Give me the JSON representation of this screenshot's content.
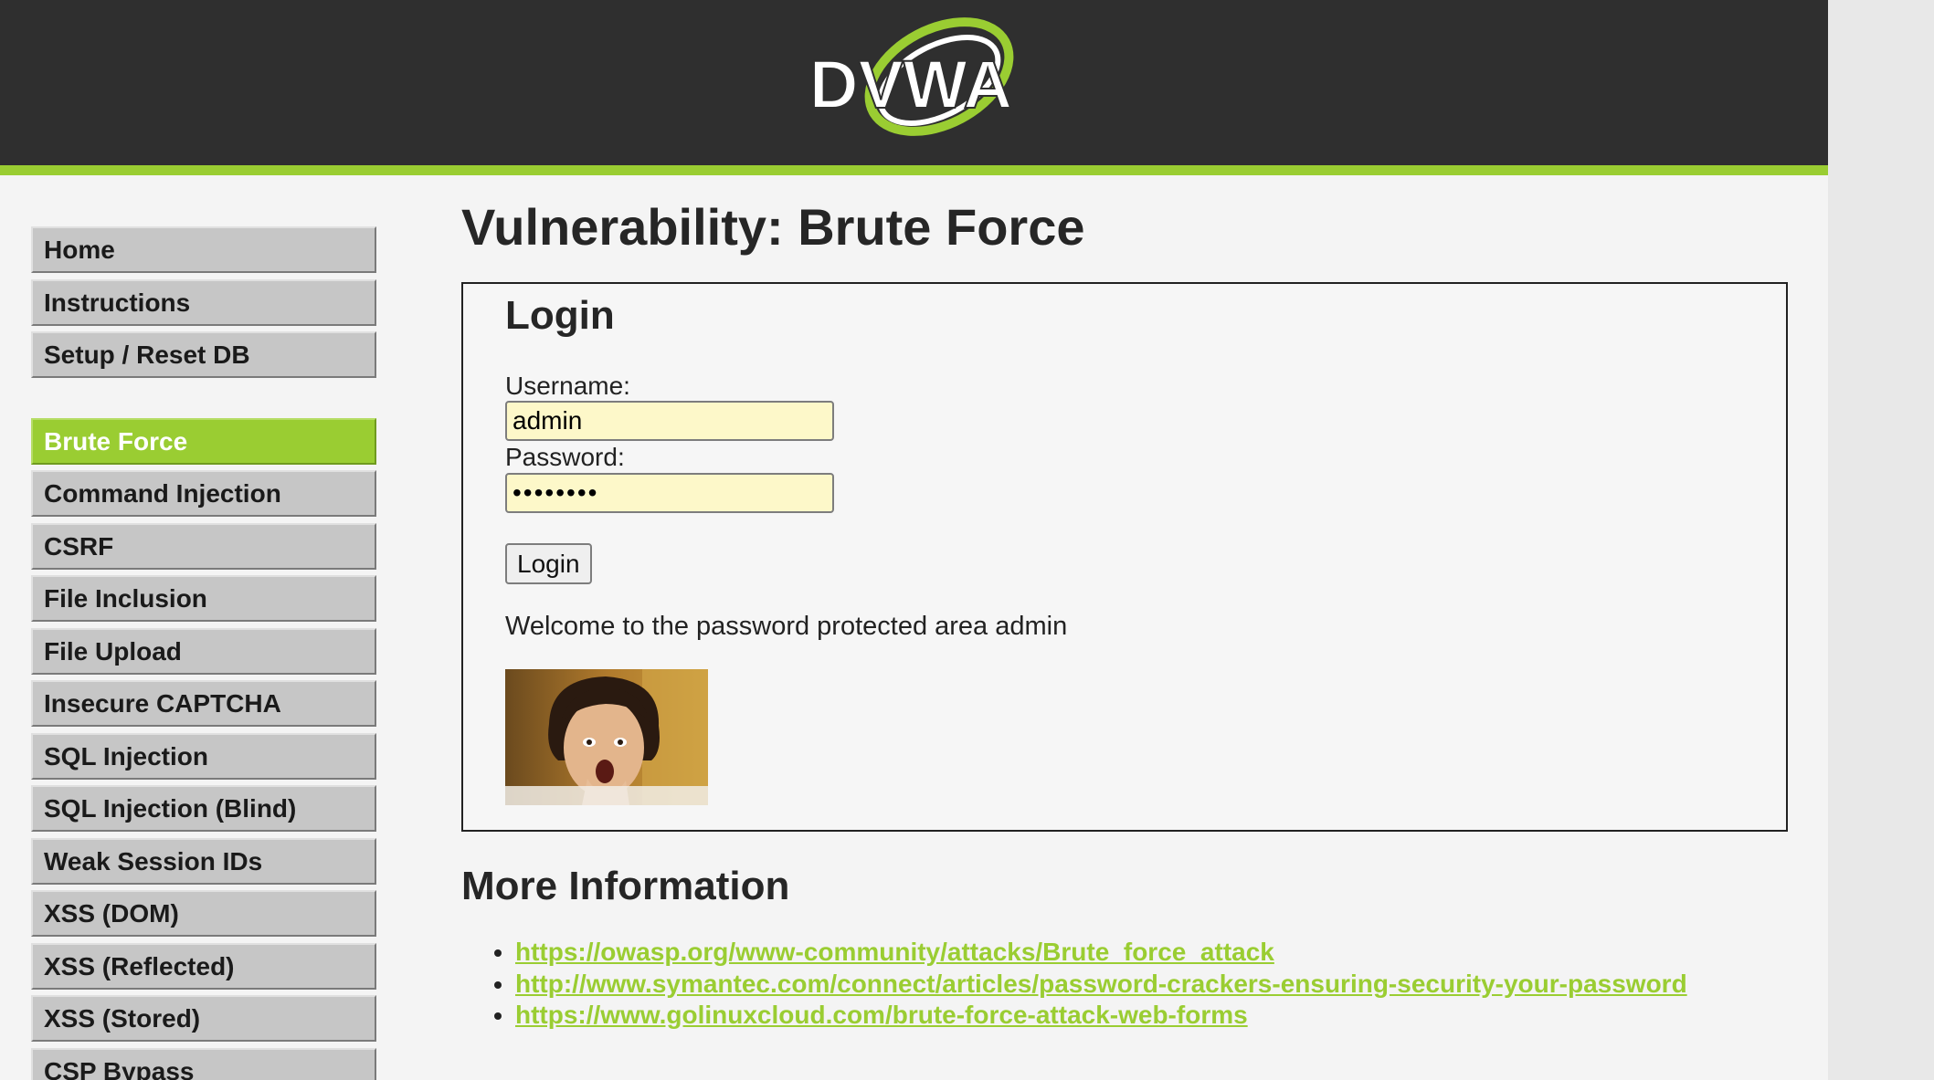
{
  "colors": {
    "header_bg": "#2f2f2f",
    "accent_green": "#9acd32",
    "nav_bg": "#c6c6c6",
    "input_bg": "#fdf8c9",
    "page_bg": "#f4f4f4"
  },
  "header": {
    "logo_text": "DVWA",
    "logo_icon": "dvwa-swoosh-logo"
  },
  "sidebar": {
    "groups": [
      {
        "items": [
          {
            "label": "Home",
            "active": false
          },
          {
            "label": "Instructions",
            "active": false
          },
          {
            "label": "Setup / Reset DB",
            "active": false
          }
        ]
      },
      {
        "items": [
          {
            "label": "Brute Force",
            "active": true
          },
          {
            "label": "Command Injection",
            "active": false
          },
          {
            "label": "CSRF",
            "active": false
          },
          {
            "label": "File Inclusion",
            "active": false
          },
          {
            "label": "File Upload",
            "active": false
          },
          {
            "label": "Insecure CAPTCHA",
            "active": false
          },
          {
            "label": "SQL Injection",
            "active": false
          },
          {
            "label": "SQL Injection (Blind)",
            "active": false
          },
          {
            "label": "Weak Session IDs",
            "active": false
          },
          {
            "label": "XSS (DOM)",
            "active": false
          },
          {
            "label": "XSS (Reflected)",
            "active": false
          },
          {
            "label": "XSS (Stored)",
            "active": false
          },
          {
            "label": "CSP Bypass",
            "active": false
          }
        ]
      }
    ]
  },
  "main": {
    "title": "Vulnerability: Brute Force",
    "login": {
      "heading": "Login",
      "username_label": "Username:",
      "username_value": "admin",
      "password_label": "Password:",
      "password_value": "password",
      "button_label": "Login",
      "welcome_message": "Welcome to the password protected area admin",
      "image_icon": "user-avatar-photo"
    },
    "more_info": {
      "heading": "More Information",
      "links": [
        "https://owasp.org/www-community/attacks/Brute_force_attack",
        "http://www.symantec.com/connect/articles/password-crackers-ensuring-security-your-password",
        "https://www.golinuxcloud.com/brute-force-attack-web-forms"
      ]
    }
  }
}
